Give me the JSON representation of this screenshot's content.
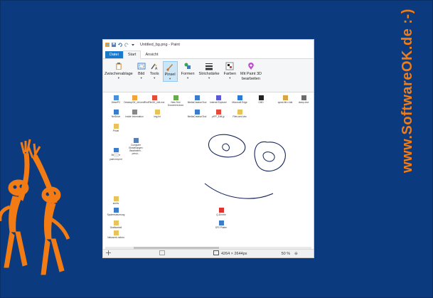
{
  "side_text": "www.SoftwareOK.de :-)",
  "colors": {
    "background": "#0b3b7e",
    "accent_orange": "#f27b14",
    "file_tab": "#1979ca"
  },
  "window": {
    "title": "Untitled_bg.png - Paint",
    "tabs": [
      "Datei",
      "Start",
      "Ansicht"
    ],
    "ribbon": [
      {
        "label": "Zwischenablage",
        "icon": "clipboard-icon"
      },
      {
        "label": "Bild",
        "icon": "image-icon"
      },
      {
        "label": "Tools",
        "icon": "tools-icon"
      },
      {
        "label": "Pinsel",
        "icon": "brush-icon"
      },
      {
        "label": "Formen",
        "icon": "shapes-icon"
      },
      {
        "label": "Strichstärke",
        "icon": "stroke-width-icon"
      },
      {
        "label": "Farben",
        "icon": "palette-icon"
      },
      {
        "label": "Mit Paint 3D",
        "label2": "bearbeiten",
        "icon": "paint3d-icon"
      }
    ],
    "status": {
      "dimensions": "4264 × 2644px",
      "zoom": "50 %"
    },
    "desktop_icons": [
      "DiesePC",
      "DesktopOK_x64.exe",
      "FindFileOK_x64.exe",
      "New Text Document.docx",
      "MediaCreationTool",
      "Internet Explorer",
      "Microsoft Edge",
      "CMD",
      "quick-file-x.bat",
      "dump.xlsx",
      "NetDrive",
      "Inside Information",
      "img.txt",
      "MediaCreationTool",
      "pfFF_Edit.jp",
      "Files.cmd.vbs",
      "Privat",
      "Benutzer",
      "Computer Einstellungen Bearbeiten - persö...",
      "paint-tmp.txt",
      "archiv",
      "Systemsteuerung",
      "Grafikarbeit",
      "Q-Dir.exe",
      "SFX Plotter",
      "Netzwerk ziehen"
    ]
  }
}
